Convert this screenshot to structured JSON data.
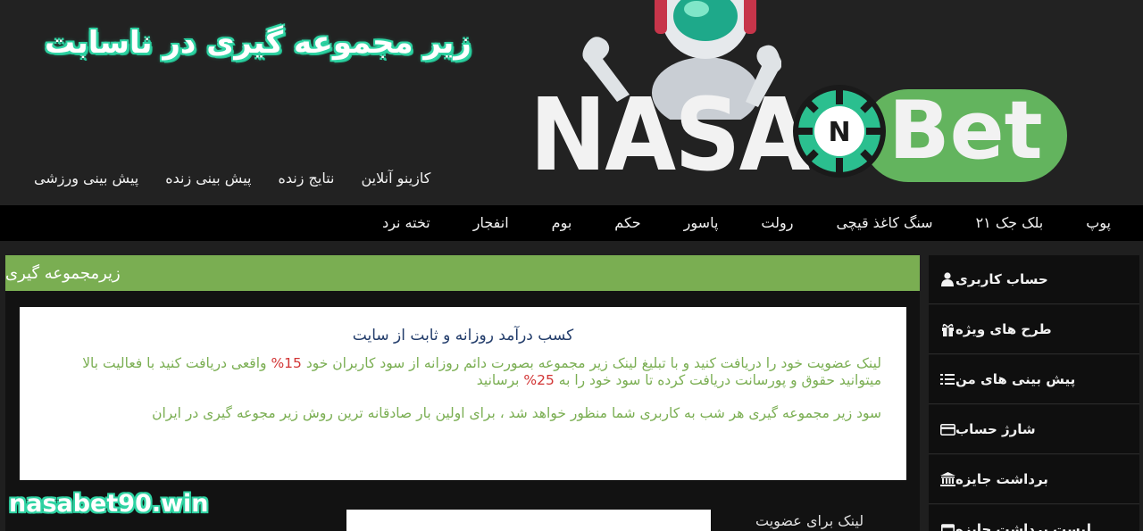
{
  "promo": {
    "title": "زیر مجموعه گیری در ناسابت"
  },
  "logo": {
    "brand_left": "NASA",
    "chip_letter": "N",
    "brand_right": "Bet"
  },
  "top_nav": {
    "items": [
      "پیش بینی ورزشی",
      "پیش بینی زنده",
      "نتایج زنده",
      "کازینو آنلاین"
    ]
  },
  "game_nav": {
    "items": [
      "تخته نرد",
      "انفجار",
      "بوم",
      "حکم",
      "پاسور",
      "رولت",
      "سنگ کاغذ قیچی",
      "بلک جک ۲۱",
      "پوپ"
    ]
  },
  "sidebar": {
    "items": [
      {
        "label": "حساب کاربری",
        "icon": "user-icon"
      },
      {
        "label": "طرح های ویژه",
        "icon": "gift-icon"
      },
      {
        "label": "پیش بینی های من",
        "icon": "list-icon"
      },
      {
        "label": "شارژ حساب",
        "icon": "credit-card-icon"
      },
      {
        "label": "برداشت جایزه",
        "icon": "bank-icon"
      },
      {
        "label": "لیست برداشت جایزه",
        "icon": "calendar-icon"
      }
    ]
  },
  "main": {
    "header": "زیرمجموعه گیری",
    "info_title": "کسب درآمد روزانه و ثابت از سایت",
    "p1_a": "لینک عضویت خود را دریافت کنید و با تبلیغ لینک زیر مجموعه بصورت دائم روزانه از سود کاربران خود ",
    "p1_pct1": "15%",
    "p1_b": " واقعی دریافت کنید با فعالیت بالا میتوانید حقوق و پورسانت دریافت کرده تا سود خود را به ",
    "p1_pct2": "25%",
    "p1_c": " برسانید",
    "p2": "سود زیر مجموعه گیری هر شب به کاربری شما منظور خواهد شد ، برای اولین بار صادقانه ترین روش زیر مجوعه گیری در ایران",
    "member_label": "لینک برای عضویت",
    "member_value": ""
  },
  "watermark": "nasabet90.win",
  "colors": {
    "accent_green": "#7aae52",
    "brand_green": "#63b45e",
    "teal": "#2fd3a3",
    "red": "#d23535",
    "navy": "#233d6b"
  }
}
